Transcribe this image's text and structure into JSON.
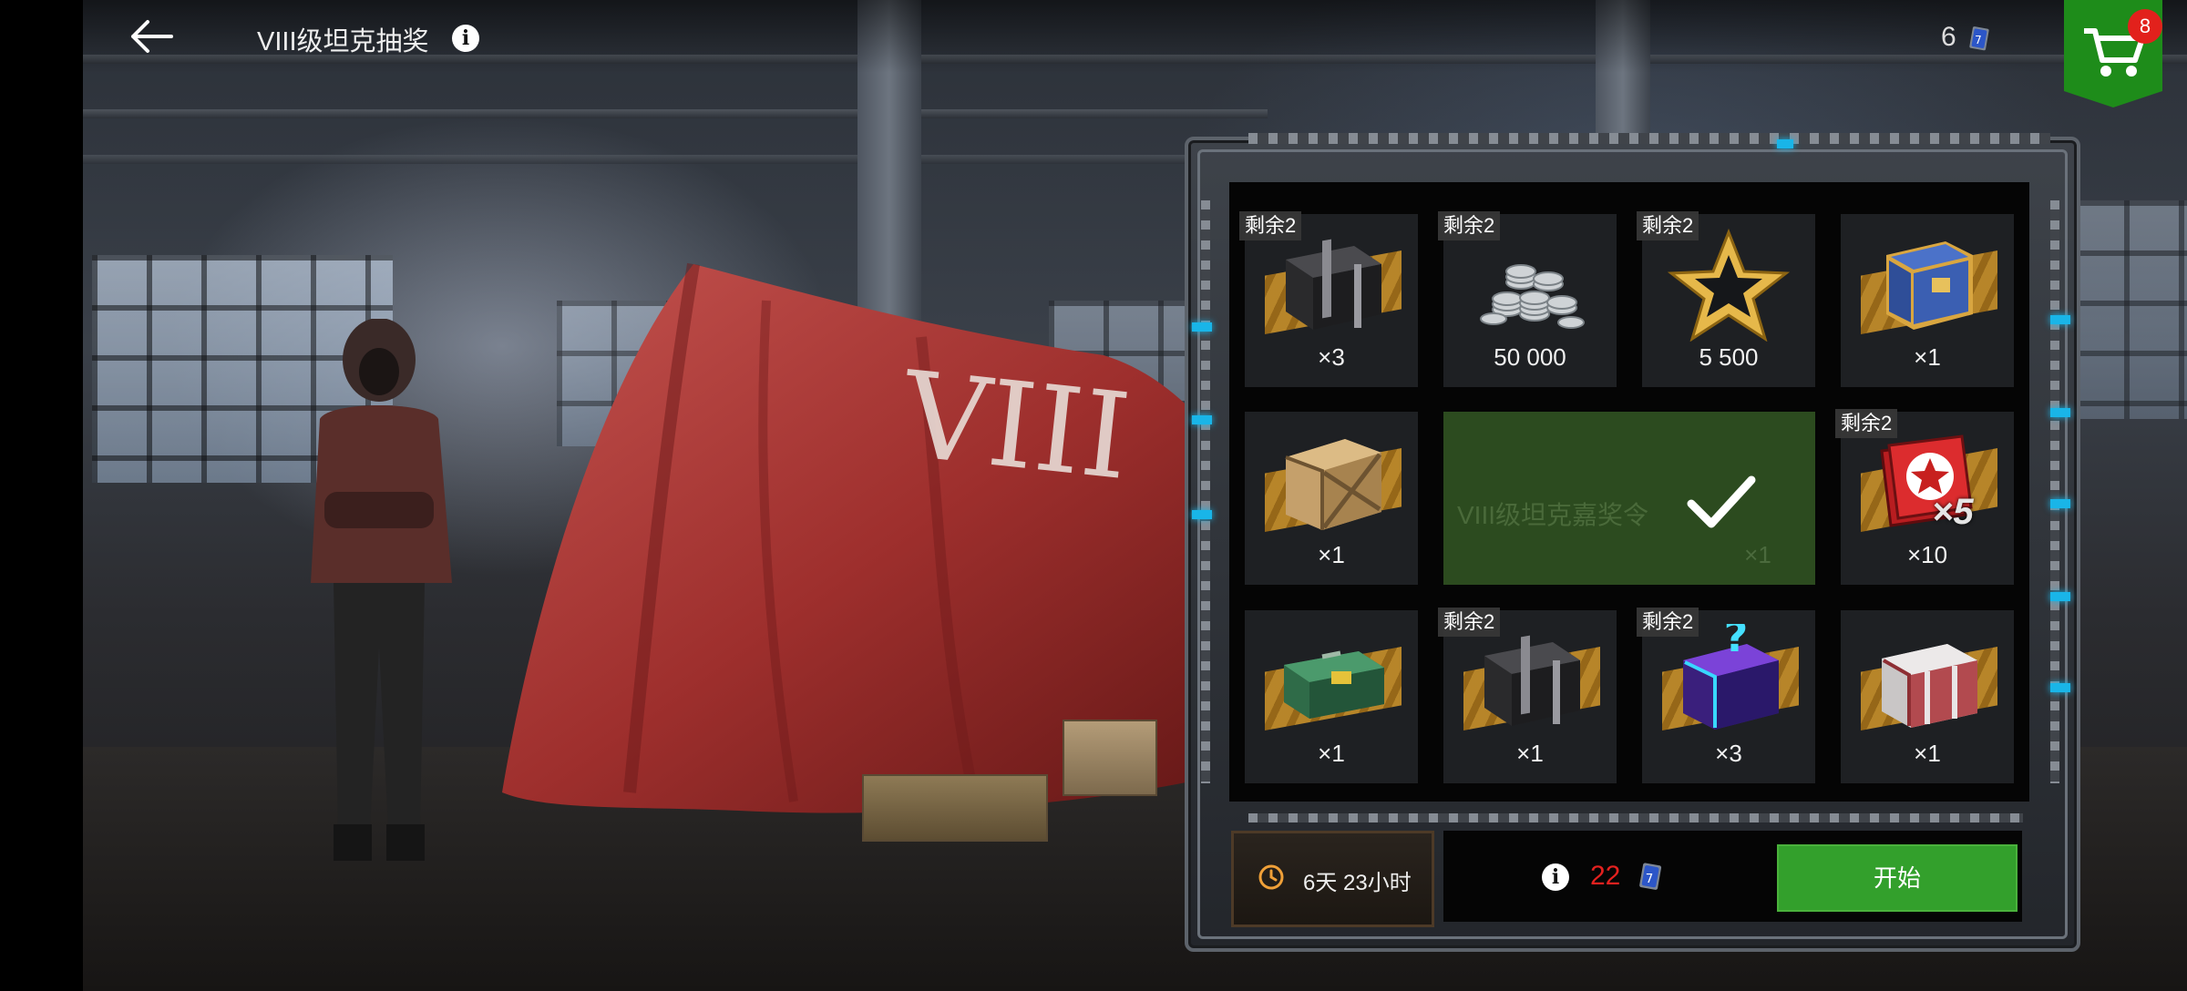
{
  "header": {
    "title": "VIII级坦克抽奖",
    "token_count": "6",
    "cart_badge": "8"
  },
  "colors": {
    "accent_green": "#33a02c",
    "cost_red": "#e3211f",
    "cart_green": "#1e8c1a",
    "badge_red": "#e2211c",
    "indicator_blue": "#19b5e8"
  },
  "scene": {
    "tarp_text": "VIII"
  },
  "rewards": [
    {
      "remaining": "剩余2",
      "icon": "black-container-icon",
      "qty": "×3"
    },
    {
      "remaining": "剩余2",
      "icon": "silver-coins-icon",
      "qty": "50 000"
    },
    {
      "remaining": "剩余2",
      "icon": "gold-star-icon",
      "qty": "5 500"
    },
    {
      "remaining": "",
      "icon": "blue-gold-container-icon",
      "qty": "×1"
    },
    {
      "remaining": "",
      "icon": "wooden-crate-icon",
      "qty": "×1"
    },
    {
      "remaining": "剩余2",
      "icon": "red-star-boost-icon",
      "qty": "×10",
      "overlay": "×5"
    },
    {
      "remaining": "",
      "icon": "green-case-icon",
      "qty": "×1"
    },
    {
      "remaining": "剩余2",
      "icon": "black-container-icon",
      "qty": "×1"
    },
    {
      "remaining": "剩余2",
      "icon": "mystery-container-icon",
      "qty": "×3"
    },
    {
      "remaining": "",
      "icon": "white-red-container-icon",
      "qty": "×1"
    }
  ],
  "won_reward": {
    "name": "VIII级坦克嘉奖令",
    "qty": "×1",
    "icon": "checkmark-icon"
  },
  "footer": {
    "timer": "6天 23小时",
    "cost": "22",
    "start_label": "开始"
  }
}
